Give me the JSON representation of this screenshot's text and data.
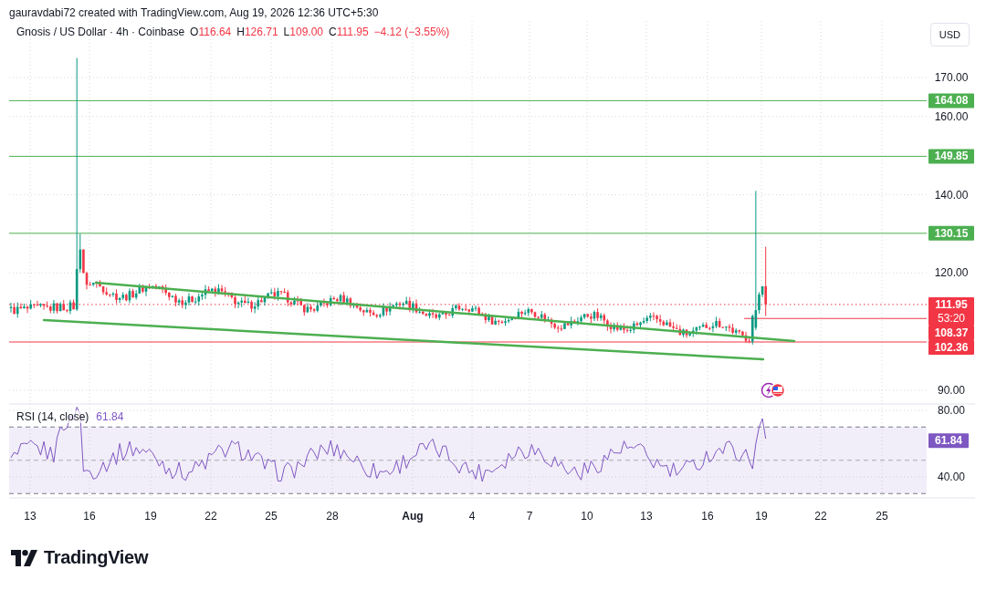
{
  "attribution": "gauravdabi72 created with TradingView.com, Aug 19, 2026 12:36 UTC+5:30",
  "legend": {
    "title": "Gnosis / US Dollar · 4h · Coinbase",
    "values": [
      {
        "key": "O",
        "value": "116.64"
      },
      {
        "key": "H",
        "value": "126.71"
      },
      {
        "key": "L",
        "value": "109.00"
      },
      {
        "key": "C",
        "value": "111.95"
      }
    ],
    "change": "−4.12 (−3.55%)"
  },
  "currency": "USD",
  "price_ticks": [
    "170.00",
    "160.00",
    "140.00",
    "120.00",
    "90.00"
  ],
  "price_tags": [
    {
      "kind": "level",
      "value": "164.08"
    },
    {
      "kind": "level",
      "value": "149.85"
    },
    {
      "kind": "level",
      "value": "130.15"
    },
    {
      "kind": "last",
      "value": "111.95",
      "countdown": "53:20"
    },
    {
      "kind": "marker",
      "value": "108.37"
    },
    {
      "kind": "line",
      "value": "102.36"
    }
  ],
  "rsi": {
    "label": "RSI (14, close)",
    "value": "61.84",
    "ticks": [
      "80.00",
      "40.00"
    ],
    "tag": "61.84"
  },
  "time_axis": [
    {
      "label": "13",
      "kind": "day"
    },
    {
      "label": "16",
      "kind": "day"
    },
    {
      "label": "19",
      "kind": "day"
    },
    {
      "label": "22",
      "kind": "day"
    },
    {
      "label": "25",
      "kind": "day"
    },
    {
      "label": "28",
      "kind": "day"
    },
    {
      "label": "Aug",
      "kind": "month"
    },
    {
      "label": "4",
      "kind": "day"
    },
    {
      "label": "7",
      "kind": "day"
    },
    {
      "label": "10",
      "kind": "day"
    },
    {
      "label": "13",
      "kind": "day"
    },
    {
      "label": "16",
      "kind": "day"
    },
    {
      "label": "19",
      "kind": "day"
    },
    {
      "label": "22",
      "kind": "day"
    },
    {
      "label": "25",
      "kind": "day"
    }
  ],
  "brand": "TradingView"
}
